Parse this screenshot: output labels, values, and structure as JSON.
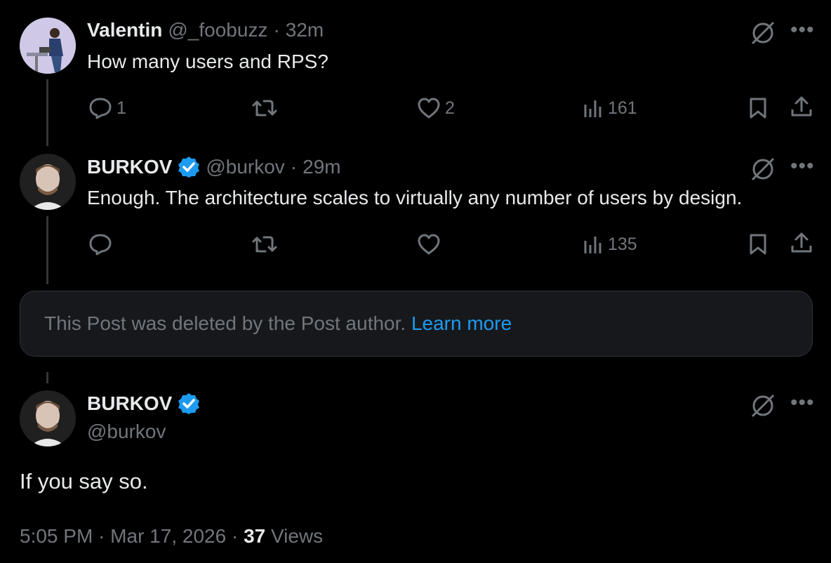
{
  "replies": [
    {
      "name": "Valentin",
      "handle": "@_foobuzz",
      "separator": "·",
      "time": "32m",
      "text": "How many users and RPS?",
      "reply_count": "1",
      "retweet_count": "",
      "like_count": "2",
      "view_count": "161",
      "verified": false
    },
    {
      "name": "BURKOV",
      "handle": "@burkov",
      "separator": "·",
      "time": "29m",
      "text": "Enough. The architecture scales to virtually any number of users by design.",
      "reply_count": "",
      "retweet_count": "",
      "like_count": "",
      "view_count": "135",
      "verified": true
    }
  ],
  "deleted_notice": {
    "text": "This Post was deleted by the Post author.",
    "link": "Learn more"
  },
  "main_post": {
    "name": "BURKOV",
    "handle": "@burkov",
    "verified": true,
    "text": "If you say so.",
    "time": "5:05 PM",
    "date": "Mar 17, 2026",
    "separator": "·",
    "views": "37",
    "views_label": "Views"
  },
  "colors": {
    "background": "#000000",
    "text": "#e7e9ea",
    "muted": "#71767b",
    "link": "#1d9bf0",
    "verified": "#1d9bf0"
  },
  "icons": [
    "reply-icon",
    "retweet-icon",
    "like-icon",
    "views-icon",
    "bookmark-icon",
    "share-icon",
    "grok-icon",
    "more-icon",
    "verified-badge-icon"
  ]
}
